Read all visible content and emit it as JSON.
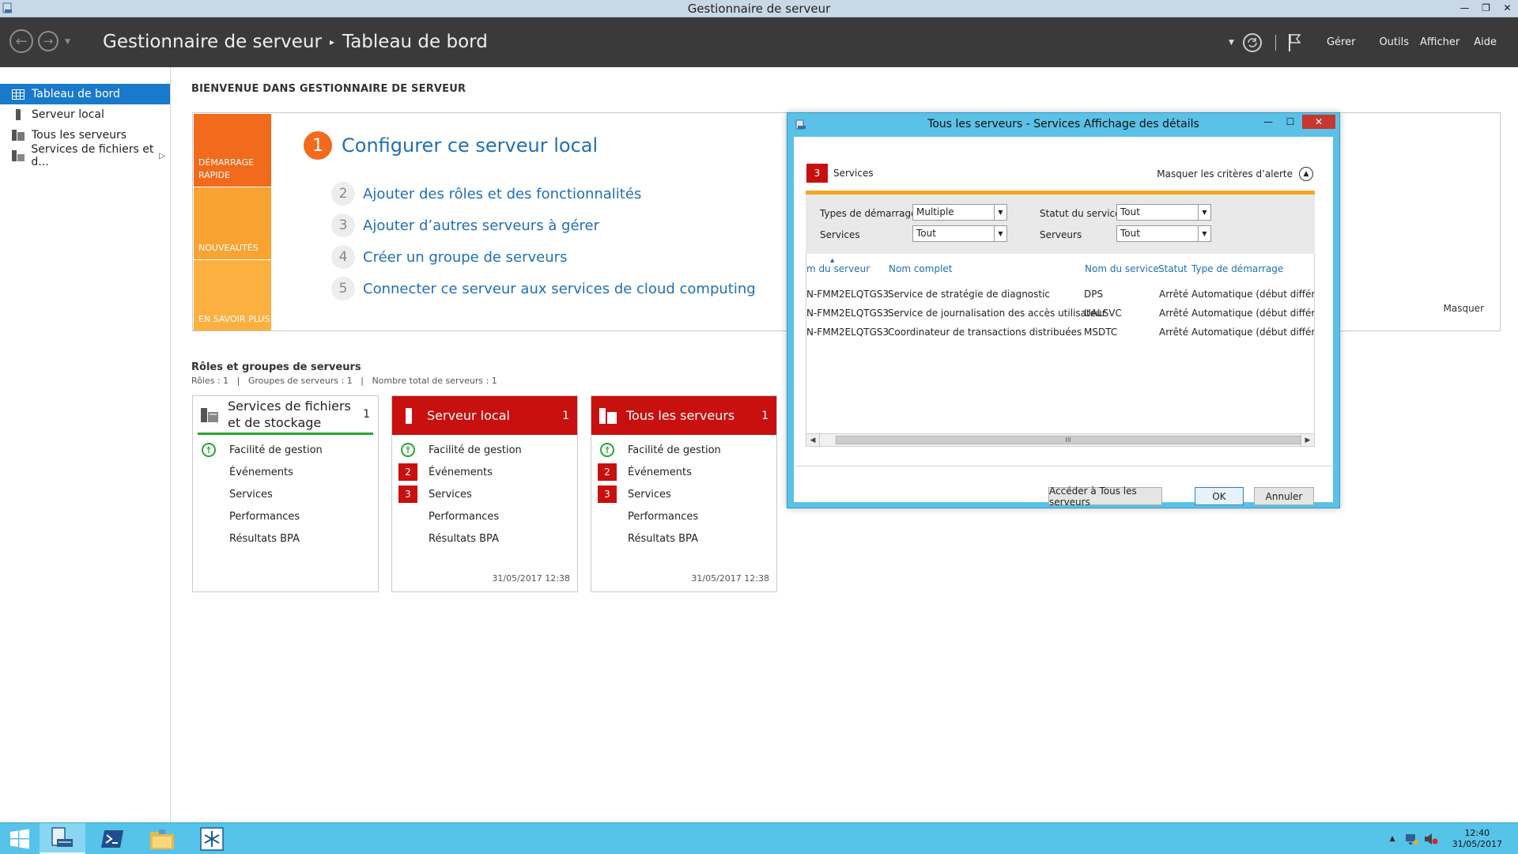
{
  "window": {
    "title": "Gestionnaire de serveur",
    "controls": [
      "—",
      "❐",
      "✕"
    ]
  },
  "header": {
    "breadcrumb_root": "Gestionnaire de serveur",
    "breadcrumb_sep": "▸",
    "breadcrumb_current": "Tableau de bord",
    "menus": [
      "Gérer",
      "Outils",
      "Afficher",
      "Aide"
    ]
  },
  "sidebar": {
    "items": [
      {
        "label": "Tableau de bord",
        "icon": "dashboard-icon"
      },
      {
        "label": "Serveur local",
        "icon": "server-icon"
      },
      {
        "label": "Tous les serveurs",
        "icon": "servers-icon"
      },
      {
        "label": "Services de fichiers et d...",
        "icon": "file-services-icon"
      }
    ]
  },
  "main": {
    "welcome": "BIENVENUE DANS GESTIONNAIRE DE SERVEUR",
    "quickstart": {
      "tabs": [
        "DÉMARRAGE RAPIDE",
        "NOUVEAUTÉS",
        "EN SAVOIR PLUS"
      ],
      "step1_num": "1",
      "step1_label": "Configurer ce serveur local",
      "steps": [
        {
          "num": "2",
          "label": "Ajouter des rôles et des fonctionnalités"
        },
        {
          "num": "3",
          "label": "Ajouter d’autres serveurs à gérer"
        },
        {
          "num": "4",
          "label": "Créer un groupe de serveurs"
        },
        {
          "num": "5",
          "label": "Connecter ce serveur aux services de cloud computing"
        }
      ],
      "hide": "Masquer"
    },
    "roles_title": "Rôles et groupes de serveurs",
    "roles_sub": "Rôles : 1   |   Groupes de serveurs : 1   |   Nombre total de serveurs : 1",
    "tiles": [
      {
        "title": "Services de fichiers et de stockage",
        "count": "1",
        "rows": [
          "Facilité de gestion",
          "Événements",
          "Services",
          "Performances",
          "Résultats BPA"
        ],
        "badges": [
          "",
          "",
          "",
          "",
          ""
        ],
        "time": ""
      },
      {
        "title": "Serveur local",
        "count": "1",
        "rows": [
          "Facilité de gestion",
          "Événements",
          "Services",
          "Performances",
          "Résultats BPA"
        ],
        "badges": [
          "",
          "2",
          "3",
          "",
          ""
        ],
        "time": "31/05/2017 12:38"
      },
      {
        "title": "Tous les serveurs",
        "count": "1",
        "rows": [
          "Facilité de gestion",
          "Événements",
          "Services",
          "Performances",
          "Résultats BPA"
        ],
        "badges": [
          "",
          "2",
          "3",
          "",
          ""
        ],
        "time": "31/05/2017 12:38"
      }
    ]
  },
  "dialog": {
    "title": "Tous les serveurs - Services Affichage des détails",
    "alert_count": "3",
    "alert_label": "Services",
    "hide_criteria": "Masquer les critères d’alerte",
    "criteria": {
      "start_type_label": "Types de démarrage",
      "start_type_value": "Multiple",
      "status_label": "Statut du service",
      "status_value": "Tout",
      "services_label": "Services",
      "services_value": "Tout",
      "servers_label": "Serveurs",
      "servers_value": "Tout"
    },
    "columns": [
      "m du serveur",
      "Nom complet",
      "Nom du service",
      "Statut",
      "Type de démarrage"
    ],
    "rows": [
      [
        "N-FMM2ELQTGS3",
        "Service de stratégie de diagnostic",
        "DPS",
        "Arrêté",
        "Automatique (début différé)"
      ],
      [
        "N-FMM2ELQTGS3",
        "Service de journalisation des accès utilisateur",
        "UALSVC",
        "Arrêté",
        "Automatique (début différé)"
      ],
      [
        "N-FMM2ELQTGS3",
        "Coordinateur de transactions distribuées",
        "MSDTC",
        "Arrêté",
        "Automatique (début différé)"
      ]
    ],
    "scroll_grip": "III",
    "buttons": {
      "goto": "Accéder à Tous les serveurs",
      "ok": "OK",
      "cancel": "Annuler"
    }
  },
  "taskbar": {
    "time": "12:40",
    "date": "31/05/2017"
  }
}
